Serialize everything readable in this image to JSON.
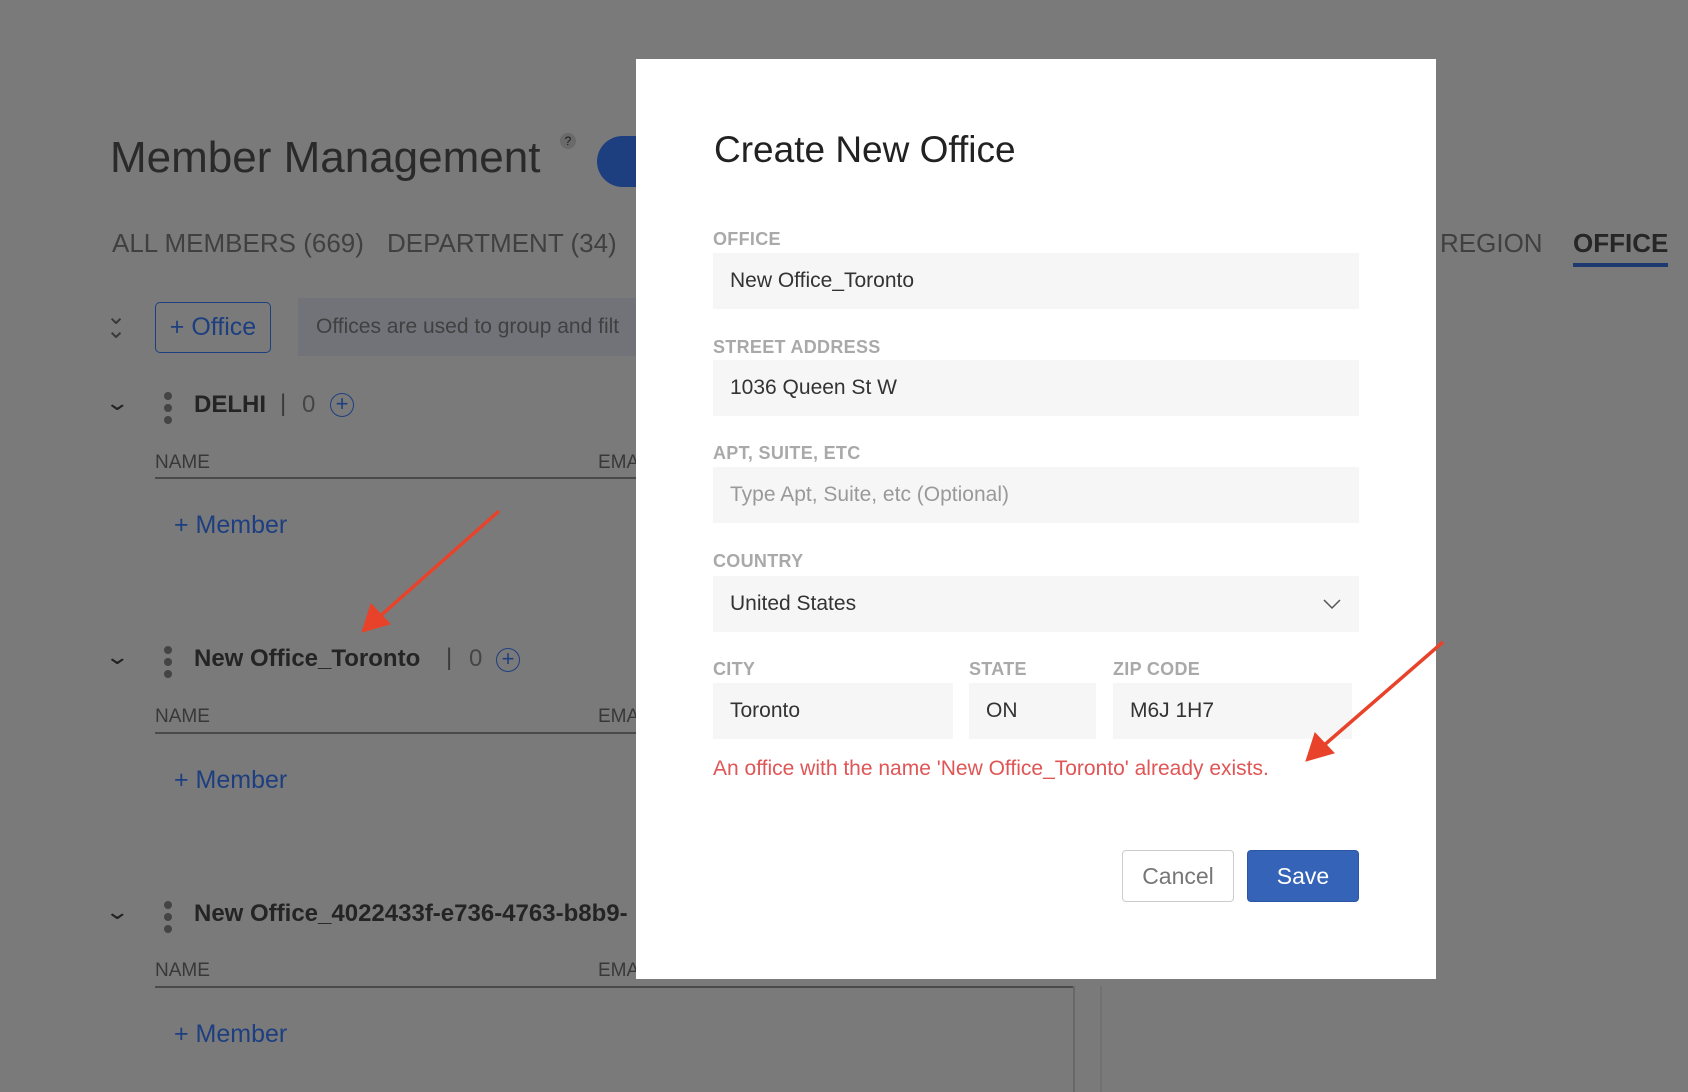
{
  "page": {
    "title": "Member Management",
    "help": "?",
    "tabs": [
      {
        "label": "ALL MEMBERS (669)",
        "active": false
      },
      {
        "label": "DEPARTMENT (34)",
        "active": false
      },
      {
        "label": "REGION",
        "active": false
      },
      {
        "label": "OFFICE",
        "active": true
      }
    ],
    "add_office_label": "+ Office",
    "info_text": "Offices are used to group and filt",
    "offices": [
      {
        "name": "DELHI",
        "count": "0"
      },
      {
        "name": "New Office_Toronto",
        "count": "0"
      },
      {
        "name": "New Office_4022433f-e736-4763-b8b9-",
        "count": ""
      }
    ],
    "col_name": "NAME",
    "col_email": "EMA",
    "add_member_label": "+ Member"
  },
  "modal": {
    "title": "Create New Office",
    "office_label": "OFFICE",
    "office_value": "New Office_Toronto",
    "street_label": "STREET ADDRESS",
    "street_value": "1036 Queen St W",
    "apt_label": "APT, SUITE, ETC",
    "apt_placeholder": "Type Apt, Suite, etc (Optional)",
    "country_label": "COUNTRY",
    "country_value": "United States",
    "city_label": "CITY",
    "city_value": "Toronto",
    "state_label": "STATE",
    "state_value": "ON",
    "zip_label": "ZIP CODE",
    "zip_value": "M6J 1H7",
    "error": "An office with the name 'New Office_Toronto' already exists.",
    "cancel_label": "Cancel",
    "save_label": "Save"
  },
  "colors": {
    "accent": "#3563b8",
    "error": "#e05555",
    "annotation_arrow": "#e8432a"
  }
}
